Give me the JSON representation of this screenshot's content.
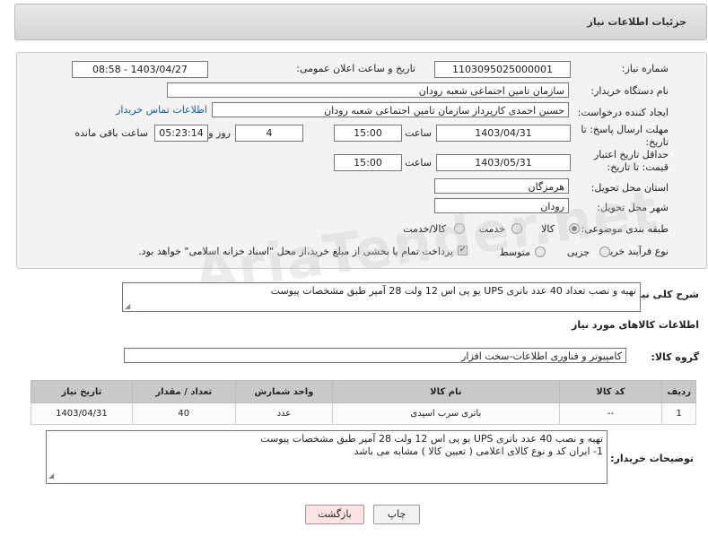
{
  "header": {
    "title": "جزئیات اطلاعات نیاز"
  },
  "form": {
    "need_number_label": "شماره نیاز:",
    "need_number": "1103095025000001",
    "announce_label": "تاریخ و ساعت اعلان عمومی:",
    "announce_value": "1403/04/27 - 08:58",
    "buyer_label": "نام دستگاه خریدار:",
    "buyer_value": "سازمان تامین اجتماعی شعبه رودان",
    "creator_label": "ایجاد کننده درخواست:",
    "creator_value": "حسین احمدی کارپرداز سازمان تامین اجتماعی شعبه رودان",
    "contact_link": "اطلاعات تماس خریدار",
    "deadline_label": "مهلت ارسال پاسخ: تا تاریخ:",
    "deadline_date": "1403/04/31",
    "time_label": "ساعت",
    "deadline_time": "15:00",
    "days_value": "4",
    "days_label": "روز و",
    "remaining_value": "05:23:14",
    "remaining_label": "ساعت باقی مانده",
    "min_price_label": "حداقل تاریخ اعتبار قیمت: تا تاریخ:",
    "min_price_date": "1403/05/31",
    "min_price_time": "15:00",
    "province_label": "استان محل تحویل:",
    "province_value": "هرمزگان",
    "city_label": "شهر محل تحویل:",
    "city_value": "رودان",
    "category_label": "طبقه بندی موضوعی:",
    "category_options": [
      "کالا",
      "خدمت",
      "کالا/خدمت"
    ],
    "category_selected": "کالا",
    "process_label": "نوع فرآیند خرید :",
    "process_options": [
      "جزیی",
      "متوسط"
    ],
    "payment_note": "پرداخت تمام یا بخشی از مبلغ خرید،از محل \"اسناد خزانه اسلامی\" خواهد بود."
  },
  "summary": {
    "label": "شرح کلی نیاز:",
    "text": "تهیه و نصب تعداد 40 عدد باتری  UPS یو پی اس 12 ولت 28 آمپر  طبق مشخصات پیوست"
  },
  "goods": {
    "section_title": "اطلاعات کالاهای مورد نیاز",
    "group_label": "گروه کالا:",
    "group_value": "کامپیوتر و فناوری اطلاعات-سخت افزار",
    "columns": [
      "ردیف",
      "کد کالا",
      "نام کالا",
      "واحد شمارش",
      "تعداد / مقدار",
      "تاریخ نیاز"
    ],
    "rows": [
      [
        "1",
        "--",
        "باتری سرب اسیدی",
        "عدد",
        "40",
        "1403/04/31"
      ]
    ]
  },
  "buyer_notes": {
    "label": "توضیحات خریدار:",
    "line1": "تهیه و نصب 40 عدد باتری  UPS یو پی اس 12 ولت 28 آمپر طبق مشخصات پیوست",
    "line2": "1- ایران کد و نوع کالای اعلامی ( تعیین کالا ) مشابه می باشد"
  },
  "buttons": {
    "print": "چاپ",
    "back": "بازگشت"
  },
  "colors": {
    "link": "#1a5ea8",
    "back_button_bg": "#fde3e3",
    "print_button_bg": "#f2f2f2"
  },
  "watermark": "AriaTender.net"
}
